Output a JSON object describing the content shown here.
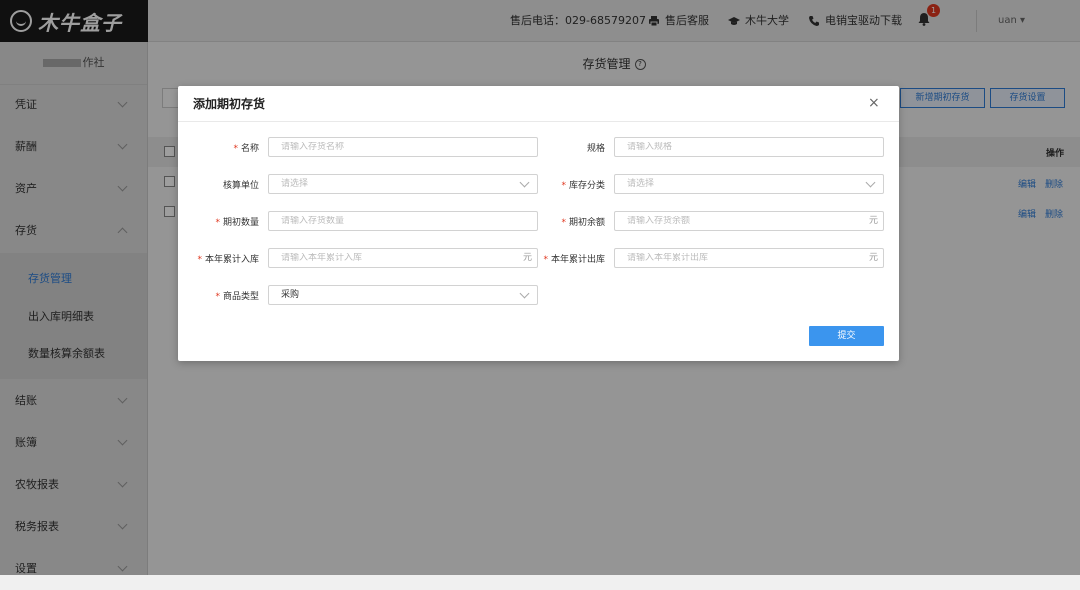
{
  "header": {
    "logo_text": "木牛盒子",
    "phone": "售后电话：029-68579207",
    "links": [
      "售后客服",
      "木牛大学",
      "电销宝驱动下载"
    ],
    "notification_count": "1",
    "user": "uan ▾"
  },
  "sidebar": {
    "company": "作社",
    "items": [
      {
        "label": "凭证"
      },
      {
        "label": "薪酬"
      },
      {
        "label": "资产"
      },
      {
        "label": "存货"
      },
      {
        "label": "结账"
      },
      {
        "label": "账簿"
      },
      {
        "label": "农牧报表"
      },
      {
        "label": "税务报表"
      },
      {
        "label": "设置"
      }
    ],
    "submenu": [
      "存货管理",
      "出入库明细表",
      "数量核算余额表"
    ],
    "active_sub": "存货管理"
  },
  "main": {
    "title": "存货管理",
    "buttons": [
      "新增期初存货",
      "存货设置"
    ],
    "table": {
      "op_header": "操作",
      "row_actions": [
        "编辑",
        "删除"
      ]
    }
  },
  "modal": {
    "title": "添加期初存货",
    "close": "×",
    "fields": {
      "name": {
        "label": "名称",
        "placeholder": "请输入存货名称",
        "required": true
      },
      "spec": {
        "label": "规格",
        "placeholder": "请输入规格",
        "required": false
      },
      "unit": {
        "label": "核算单位",
        "placeholder": "请选择",
        "required": false
      },
      "category": {
        "label": "库存分类",
        "placeholder": "请选择",
        "required": true
      },
      "init_qty": {
        "label": "期初数量",
        "placeholder": "请输入存货数量",
        "required": true
      },
      "init_balance": {
        "label": "期初余额",
        "placeholder": "请输入存货余额",
        "unit": "元",
        "required": true
      },
      "year_in": {
        "label": "本年累计入库",
        "placeholder": "请输入本年累计入库",
        "unit": "元",
        "required": true
      },
      "year_out": {
        "label": "本年累计出库",
        "placeholder": "请输入本年累计出库",
        "unit": "元",
        "required": true
      },
      "goods_type": {
        "label": "商品类型",
        "value": "采购",
        "required": true
      }
    },
    "submit": "提交"
  },
  "colors": {
    "accent": "#2e7bd6",
    "submit_bg": "#3b95ee",
    "required": "#e0371f",
    "logo_bg": "#1b1b1b"
  }
}
